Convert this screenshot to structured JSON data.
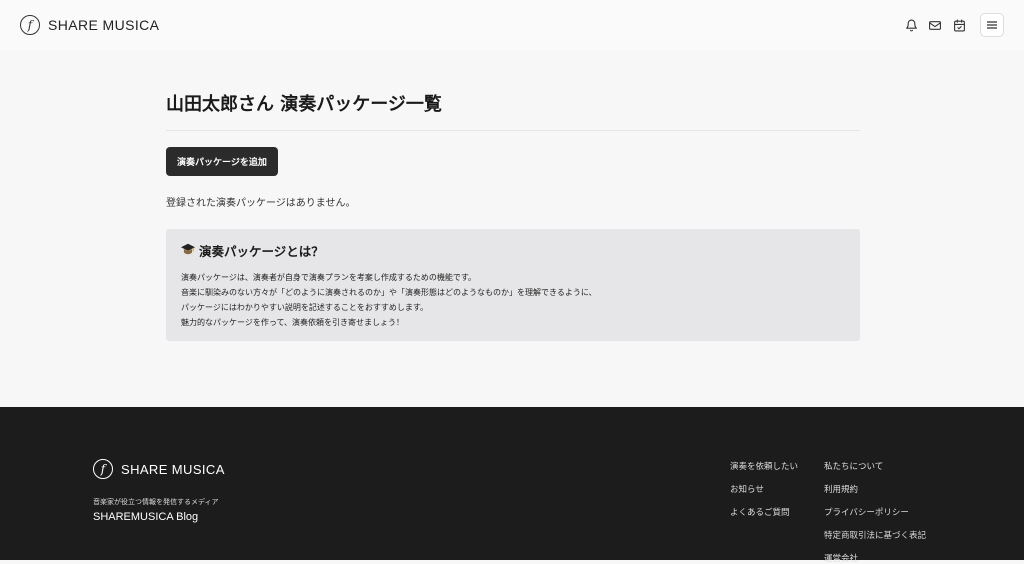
{
  "header": {
    "logo_text": "SHARE MUSICA",
    "icons": [
      "bell-icon",
      "mail-icon",
      "calendar-check-icon",
      "menu-icon"
    ]
  },
  "main": {
    "title": "山田太郎さん 演奏パッケージ一覧",
    "add_button": "演奏パッケージを追加",
    "empty_message": "登録された演奏パッケージはありません。",
    "info": {
      "title": "演奏パッケージとは？",
      "lines": [
        "演奏パッケージは、演奏者が自身で演奏プランを考案し作成するための機能です。",
        "音楽に馴染みのない方々が「どのように演奏されるのか」や「演奏形態はどのようなものか」を理解できるように、",
        "パッケージにはわかりやすい説明を記述することをおすすめします。",
        "魅力的なパッケージを作って、演奏依頼を引き寄せましょう！"
      ]
    }
  },
  "footer": {
    "logo_text": "SHARE MUSICA",
    "tagline": "音楽家が役立つ情報を発信するメディア",
    "blog": "SHAREMUSICA Blog",
    "col1": [
      "演奏を依頼したい",
      "お知らせ",
      "よくあるご質問"
    ],
    "col2": [
      "私たちについて",
      "利用規約",
      "プライバシーポリシー",
      "特定商取引法に基づく表記",
      "運営会社"
    ]
  }
}
